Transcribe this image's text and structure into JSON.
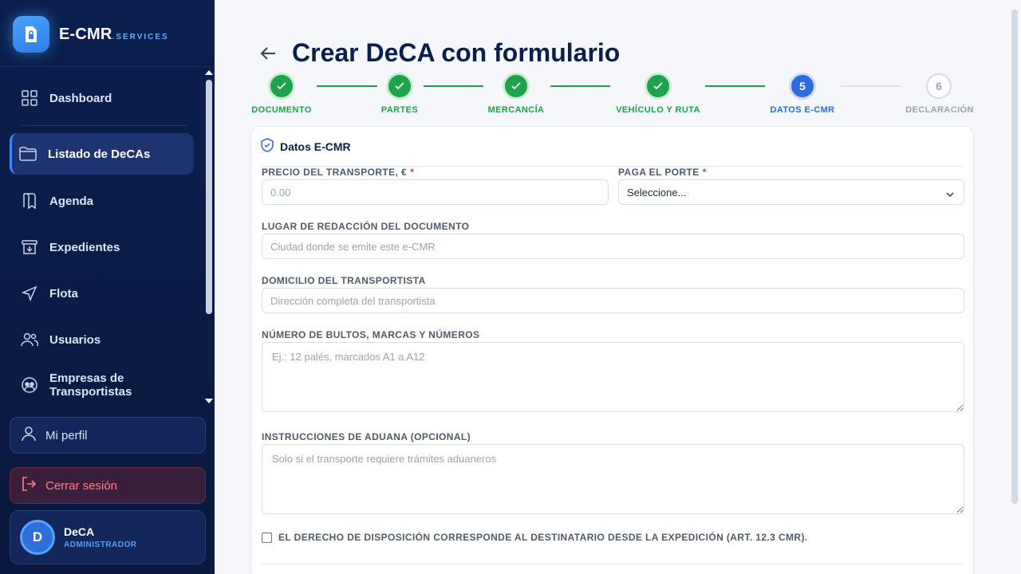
{
  "brand": {
    "name": "E-CMR",
    "suffix": ".SERVICES"
  },
  "sidebar": {
    "items": [
      {
        "label": "Dashboard",
        "icon": "grid-icon"
      },
      {
        "label": "Listado de DeCAs",
        "icon": "folder-icon",
        "active": true
      },
      {
        "label": "Agenda",
        "icon": "book-icon"
      },
      {
        "label": "Expedientes",
        "icon": "archive-icon"
      },
      {
        "label": "Flota",
        "icon": "navigation-icon"
      },
      {
        "label": "Usuarios",
        "icon": "users-icon"
      },
      {
        "label": "Empresas de Transportistas",
        "icon": "company-icon"
      }
    ],
    "profile_label": "Mi perfil",
    "logout_label": "Cerrar sesión",
    "user": {
      "initial": "D",
      "name": "DeCA",
      "role": "ADMINISTRADOR"
    }
  },
  "page": {
    "title": "Crear DeCA con formulario"
  },
  "stepper": {
    "steps": [
      {
        "label": "DOCUMENTO",
        "state": "done",
        "number": ""
      },
      {
        "label": "PARTES",
        "state": "done",
        "number": ""
      },
      {
        "label": "MERCANCÍA",
        "state": "done",
        "number": ""
      },
      {
        "label": "VEHÍCULO Y RUTA",
        "state": "done",
        "number": ""
      },
      {
        "label": "DATOS E-CMR",
        "state": "current",
        "number": "5"
      },
      {
        "label": "DECLARACIÓN",
        "state": "todo",
        "number": "6"
      }
    ]
  },
  "form": {
    "section_title": "Datos E-CMR",
    "price": {
      "label": "PRECIO DEL TRANSPORTE, €",
      "required": "*",
      "placeholder": "0.00"
    },
    "payer": {
      "label": "PAGA EL PORTE",
      "required": "*",
      "value": "Seleccione..."
    },
    "place": {
      "label": "LUGAR DE REDACCIÓN DEL DOCUMENTO",
      "placeholder": "Ciudad donde se emite este e-CMR"
    },
    "address": {
      "label": "DOMICILIO DEL TRANSPORTISTA",
      "placeholder": "Dirección completa del transportista"
    },
    "packages": {
      "label": "NÚMERO DE BULTOS, MARCAS Y NÚMEROS",
      "placeholder": "Ej.: 12 palés, marcados A1 a A12"
    },
    "customs": {
      "label": "INSTRUCCIONES DE ADUANA (OPCIONAL)",
      "placeholder": "Solo si el transporte requiere trámites aduaneros"
    },
    "disposal_checkbox": {
      "label": "EL DERECHO DE DISPOSICIÓN CORRESPONDE AL DESTINATARIO DESDE LA EXPEDICIÓN (ART. 12.3 CMR).",
      "checked": false
    }
  },
  "colors": {
    "sidebar_bg": "#0b1f4d",
    "accent": "#2f6be0",
    "success": "#1fa34a",
    "danger": "#ff7d8a"
  }
}
